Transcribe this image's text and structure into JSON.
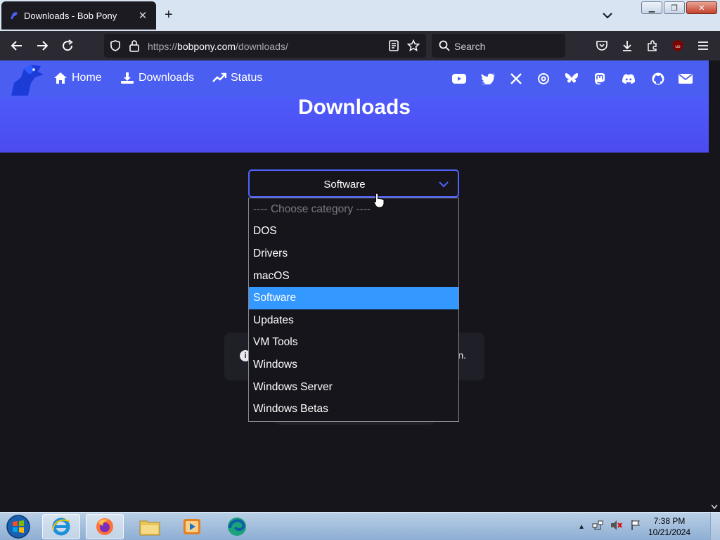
{
  "browser": {
    "tab_title": "Downloads - Bob Pony",
    "new_tab_label": "+",
    "url_prefix": "https://",
    "url_domain": "bobpony.com",
    "url_path": "/downloads/",
    "search_placeholder": "Search"
  },
  "site": {
    "nav": [
      {
        "label": "Home",
        "icon": "home-icon"
      },
      {
        "label": "Downloads",
        "icon": "download-icon"
      },
      {
        "label": "Status",
        "icon": "trending-icon"
      }
    ],
    "social_icons": [
      "youtube-icon",
      "twitter-icon",
      "x-icon",
      "threads-icon",
      "bluesky-icon",
      "mastodon-icon",
      "discord-icon",
      "github-icon",
      "email-icon"
    ],
    "page_title": "Downloads",
    "accent_color": "#4f5ff5"
  },
  "category_select": {
    "selected": "Software",
    "options": [
      "---- Choose category ----",
      "DOS",
      "Drivers",
      "macOS",
      "Software",
      "Updates",
      "VM Tools",
      "Windows",
      "Windows Server",
      "Windows Betas"
    ],
    "highlighted_index": 4,
    "highlight_color": "#3398ff"
  },
  "info_box": {
    "trailing_text": "n."
  },
  "taskbar": {
    "apps": [
      "internet-explorer-icon",
      "firefox-icon",
      "file-explorer-icon",
      "media-player-icon",
      "edge-icon"
    ],
    "time": "7:38 PM",
    "date": "10/21/2024"
  }
}
